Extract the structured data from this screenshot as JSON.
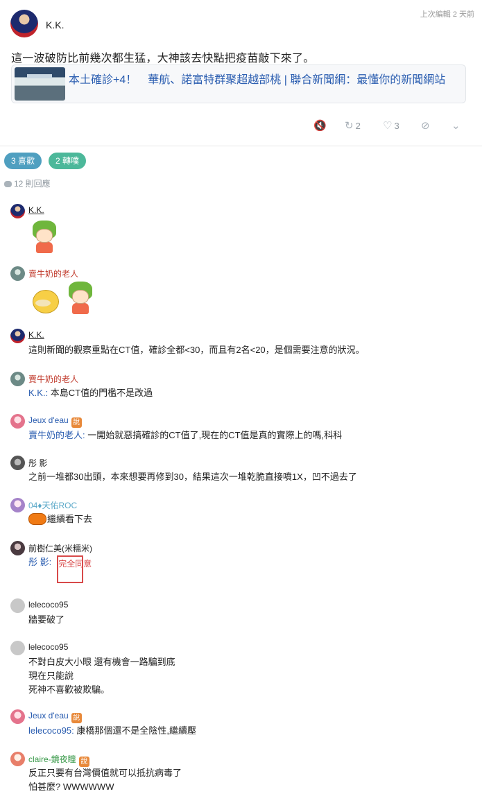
{
  "post": {
    "author": "K.K.",
    "edited": "上次編輯 2 天前",
    "text": "這一波破防比前幾次都生猛，大神該去快點把疫苗敲下來了。",
    "link_title": "本土確診+4！　華航、諾富特群聚超越部桃 | 聯合新聞網：最懂你的新聞網站",
    "repost_count": "2",
    "like_count": "3"
  },
  "pills": {
    "likes": "3 喜歡",
    "reposts": "2 轉噗"
  },
  "reply_count": "12 則回應",
  "colors": {
    "mention": "#2a5db0",
    "milk": "#c0392b",
    "jeux": "#2a5db0",
    "roc": "#5aa8c8",
    "claire": "#3a9a4a"
  },
  "comments": [
    {
      "name": "K.K."
    },
    {
      "name": "賣牛奶的老人"
    },
    {
      "name": "K.K.",
      "text": "這則新聞的觀察重點在CT值，確診全都<30，而且有2名<20，是個需要注意的狀況。"
    },
    {
      "name": "賣牛奶的老人",
      "mention": "K.K.:",
      "text": " 本島CT值的門檻不是改過"
    },
    {
      "name": "Jeux d'eau",
      "badge": "說",
      "mention": "賣牛奶的老人:",
      "text": " 一開始就惡搞確診的CT值了,現在的CT值是真的實際上的嗎,科科"
    },
    {
      "name": "彤 影",
      "text": "之前一堆都30出頭，本來想要再修到30，結果這次一堆乾脆直接噴1X，凹不過去了"
    },
    {
      "name": "04♦天佑ROC",
      "text": "繼續看下去"
    },
    {
      "name": "前樹仁美(米糯米)",
      "mention": "彤 影:",
      "stamp": "完全同意"
    },
    {
      "name": "lelecoco95",
      "text": "牆要破了"
    },
    {
      "name": "lelecoco95",
      "lines": [
        "不對白皮大小眼 還有機會一路騙到底",
        "現在只能說",
        "死神不喜歡被欺騙。"
      ]
    },
    {
      "name": "Jeux d'eau",
      "badge": "說",
      "mention": "lelecoco95:",
      "text": " 康橋那個還不是全陰性,繼續壓"
    },
    {
      "name": "claire-鏡夜瞳",
      "badge": "說",
      "lines": [
        "反正只要有台灣價值就可以抵抗病毒了",
        "怕甚麼? WWWWWW"
      ]
    }
  ]
}
